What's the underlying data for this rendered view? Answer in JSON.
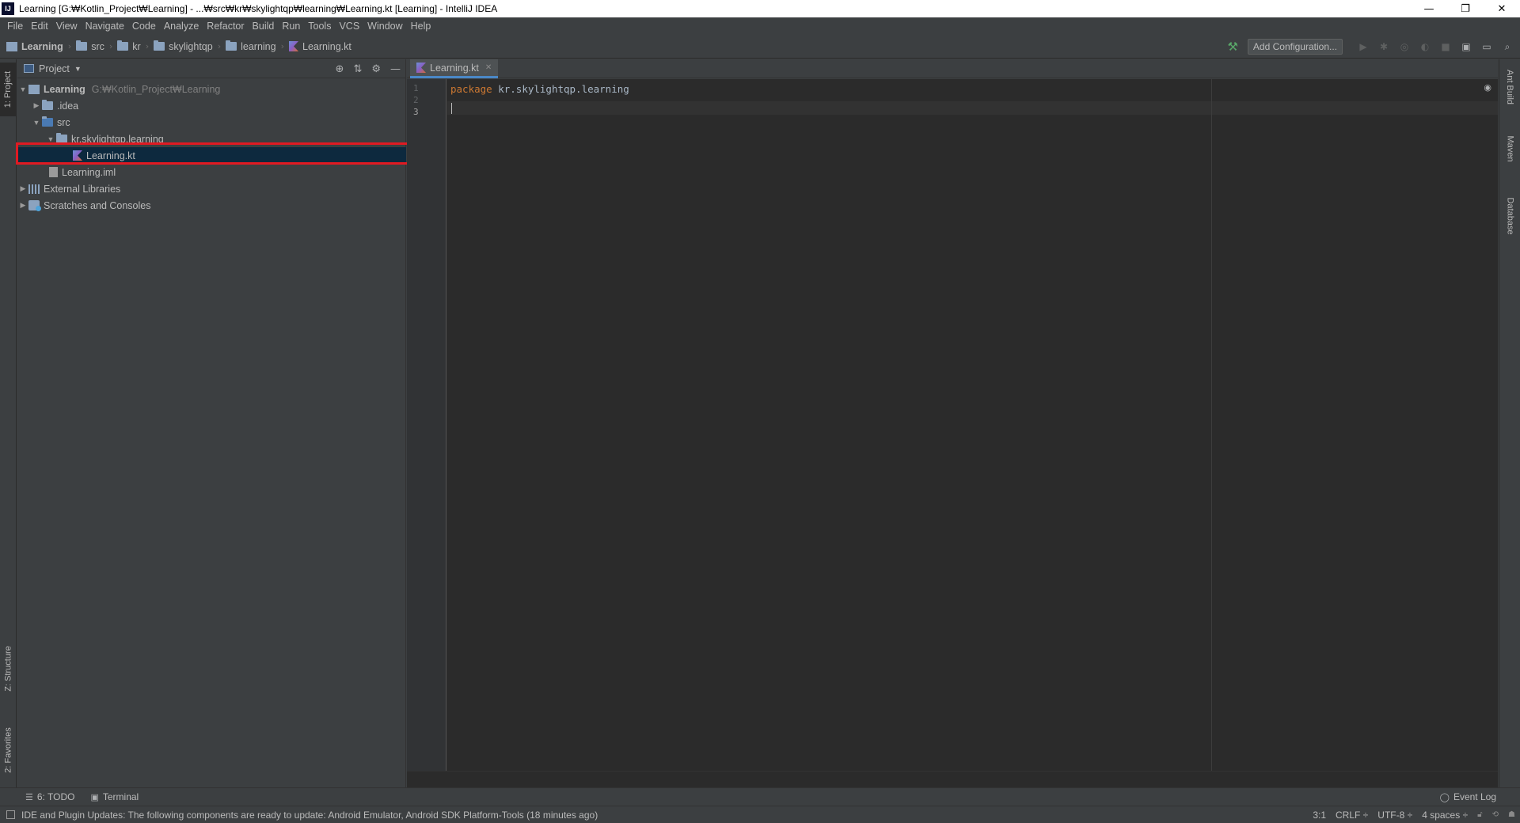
{
  "window": {
    "title": "Learning [G:₩Kotlin_Project₩Learning] - ...₩src₩kr₩skylightqp₩learning₩Learning.kt [Learning] - IntelliJ IDEA",
    "icon_text": "IJ",
    "minimize": "—",
    "restore": "❐",
    "close": "✕"
  },
  "menu": [
    "File",
    "Edit",
    "View",
    "Navigate",
    "Code",
    "Analyze",
    "Refactor",
    "Build",
    "Run",
    "Tools",
    "VCS",
    "Window",
    "Help"
  ],
  "breadcrumb": {
    "items": [
      "Learning",
      "src",
      "kr",
      "skylightqp",
      "learning",
      "Learning.kt"
    ],
    "add_configuration": "Add Configuration..."
  },
  "left_strip": {
    "project_tab": "1: Project",
    "structure_tab": "Z: Structure",
    "favorites_tab": "2: Favorites"
  },
  "project_panel": {
    "title": "Project",
    "tree": {
      "root": "Learning",
      "root_path": "G:₩Kotlin_Project₩Learning",
      "idea": ".idea",
      "src": "src",
      "package": "kr.skylightqp.learning",
      "file": "Learning.kt",
      "iml": "Learning.iml",
      "external_libraries": "External Libraries",
      "scratches": "Scratches and Consoles"
    }
  },
  "editor": {
    "tab_label": "Learning.kt",
    "line_numbers": [
      "1",
      "2",
      "3"
    ],
    "code": {
      "keyword": "package",
      "package_name": " kr.skylightqp.learning"
    }
  },
  "right_strip": {
    "ant": "Ant Build",
    "maven": "Maven",
    "database": "Database"
  },
  "bottom_tools": {
    "todo": "6: TODO",
    "terminal": "Terminal",
    "event_log": "Event Log"
  },
  "status": {
    "message": "IDE and Plugin Updates: The following components are ready to update: Android Emulator, Android SDK Platform-Tools (18 minutes ago)",
    "position": "3:1",
    "line_sep": "CRLF ÷",
    "encoding": "UTF-8 ÷",
    "indent": "4 spaces ÷"
  }
}
